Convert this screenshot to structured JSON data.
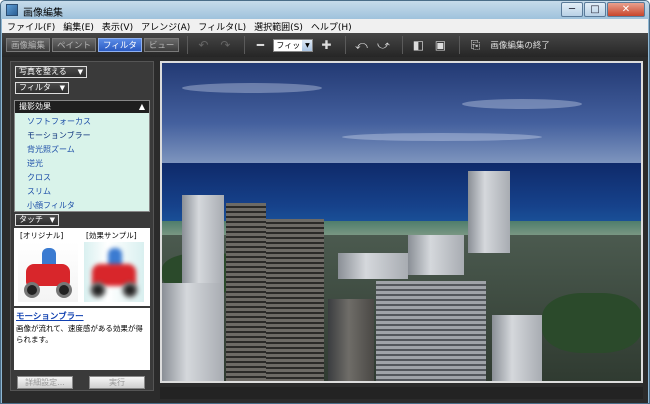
{
  "window": {
    "title": "画像編集",
    "min_label": "─",
    "max_label": "□",
    "close_label": "✕"
  },
  "menu": [
    "ファイル(F)",
    "編集(E)",
    "表示(V)",
    "アレンジ(A)",
    "フィルタ(L)",
    "選択範囲(S)",
    "ヘルプ(H)"
  ],
  "toolbar": {
    "mode_tabs": [
      "画像編集",
      "ペイント",
      "フィルタ",
      "ビュー"
    ],
    "active_tab": "フィルタ",
    "zoom_value": "フィット",
    "end_label": "画像編集の終了",
    "icons": [
      "undo-icon",
      "redo-icon",
      "zoom-out-icon",
      "zoom-in-icon",
      "rotate-left-icon",
      "rotate-right-icon",
      "fit-window-icon",
      "actual-size-icon",
      "end-editing-icon"
    ]
  },
  "left_panel": {
    "category_dropdown": "写真を整える",
    "type_dropdown": "フィルタ",
    "group_header": "撮影効果",
    "effects": [
      "ソフトフォーカス",
      "モーションブラー",
      "背光照ズーム",
      "逆光",
      "クロス",
      "スリム",
      "小顔フィルタ"
    ],
    "selected_effect": "モーションブラー",
    "touch_dropdown": "タッチ",
    "sample_original_label": "[オリジナル]",
    "sample_effect_label": "[効果サンプル]",
    "description_title": "モーションブラー",
    "description_text": "画像が流れて、速度感がある効果が得られます。",
    "detail_button": "詳細設定...",
    "run_button": "実行"
  },
  "colors": {
    "toolbar_bg": "#2f2f2f",
    "active_tab": "#3a6ed4",
    "list_bg": "#d9f3ea",
    "link_blue": "#1b4da8"
  }
}
